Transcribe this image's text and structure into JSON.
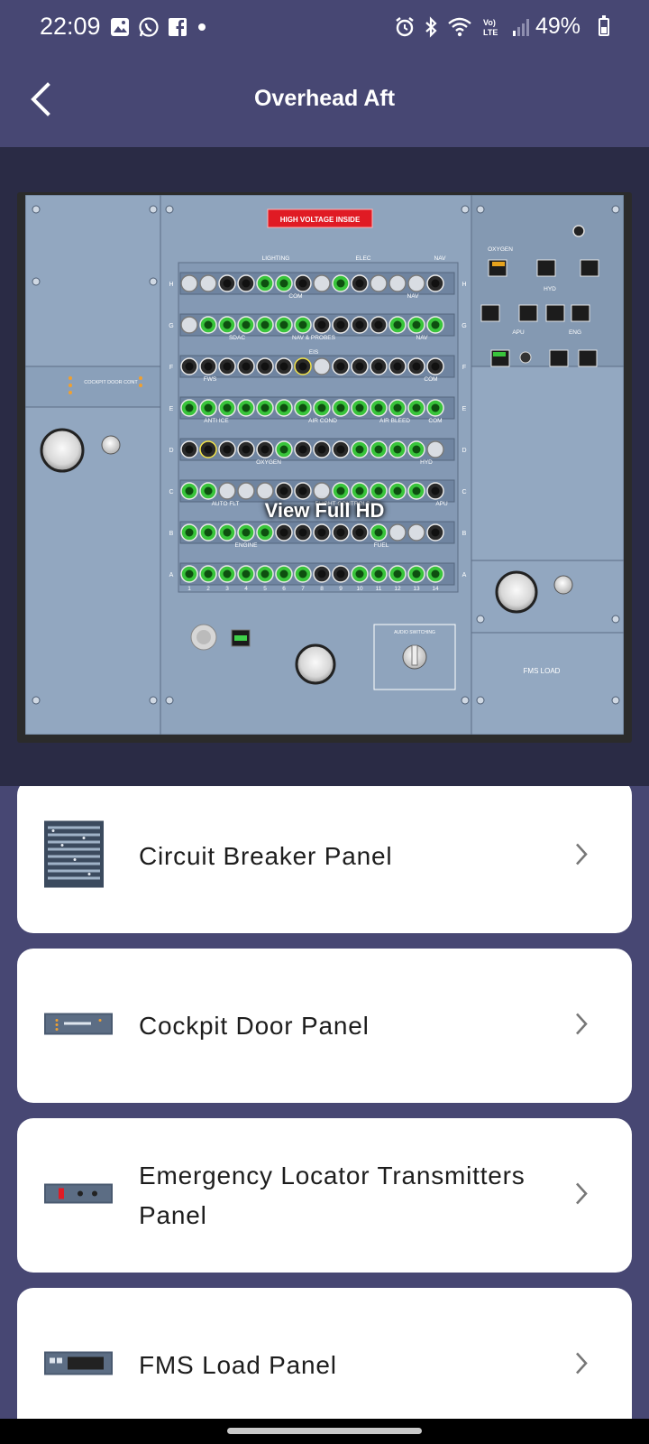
{
  "status_bar": {
    "time": "22:09",
    "battery": "49%",
    "left_icons": [
      "gallery-icon",
      "whatsapp-icon",
      "facebook-icon",
      "dot-icon"
    ],
    "right_icons": [
      "alarm-icon",
      "bluetooth-icon",
      "wifi-icon",
      "volte-icon",
      "signal-icon",
      "battery-icon"
    ],
    "battery_level": 0.49
  },
  "header": {
    "title": "Overhead Aft",
    "back_icon": "back-arrow-icon"
  },
  "preview": {
    "warning_label": "HIGH VOLTAGE INSIDE",
    "view_full_label": "View Full HD",
    "fms_label": "FMS LOAD",
    "audio_switching_label": "AUDIO SWITCHING",
    "cockpit_door_label": "COCKPIT DOOR CONT",
    "row_letters": [
      "H",
      "G",
      "F",
      "E",
      "D",
      "C",
      "B",
      "A"
    ],
    "column_numbers": [
      "1",
      "2",
      "3",
      "4",
      "5",
      "6",
      "7",
      "8",
      "9",
      "10",
      "11",
      "12",
      "13",
      "14"
    ],
    "section_labels": [
      "LIGHTING",
      "ELEC",
      "NAV",
      "COM",
      "NAV",
      "SDAC",
      "NAV & PROBES",
      "NAV",
      "FWS",
      "EIS",
      "COM",
      "ANTI ICE",
      "AIR COND",
      "AIR BLEED",
      "COM",
      "OXYGEN",
      "HYD",
      "AUTO FLT",
      "FLIGHT CONTROLS",
      "APU",
      "ENGINE",
      "FUEL"
    ],
    "right_panel_labels": [
      "OXYGEN",
      "HYD",
      "APU",
      "ENG"
    ],
    "colors": {
      "panel": "#8fa4bd",
      "breaker_green": "#39c43b",
      "warning_red": "#e01b24"
    }
  },
  "list": {
    "items": [
      {
        "label": "Circuit Breaker Panel",
        "thumb_icon": "circuit-breaker-thumb"
      },
      {
        "label": "Cockpit Door Panel",
        "thumb_icon": "cockpit-door-thumb"
      },
      {
        "label": "Emergency Locator Transmitters Panel",
        "thumb_icon": "elt-thumb"
      },
      {
        "label": "FMS Load Panel",
        "thumb_icon": "fms-thumb"
      }
    ],
    "chevron_icon": "chevron-right-icon"
  }
}
